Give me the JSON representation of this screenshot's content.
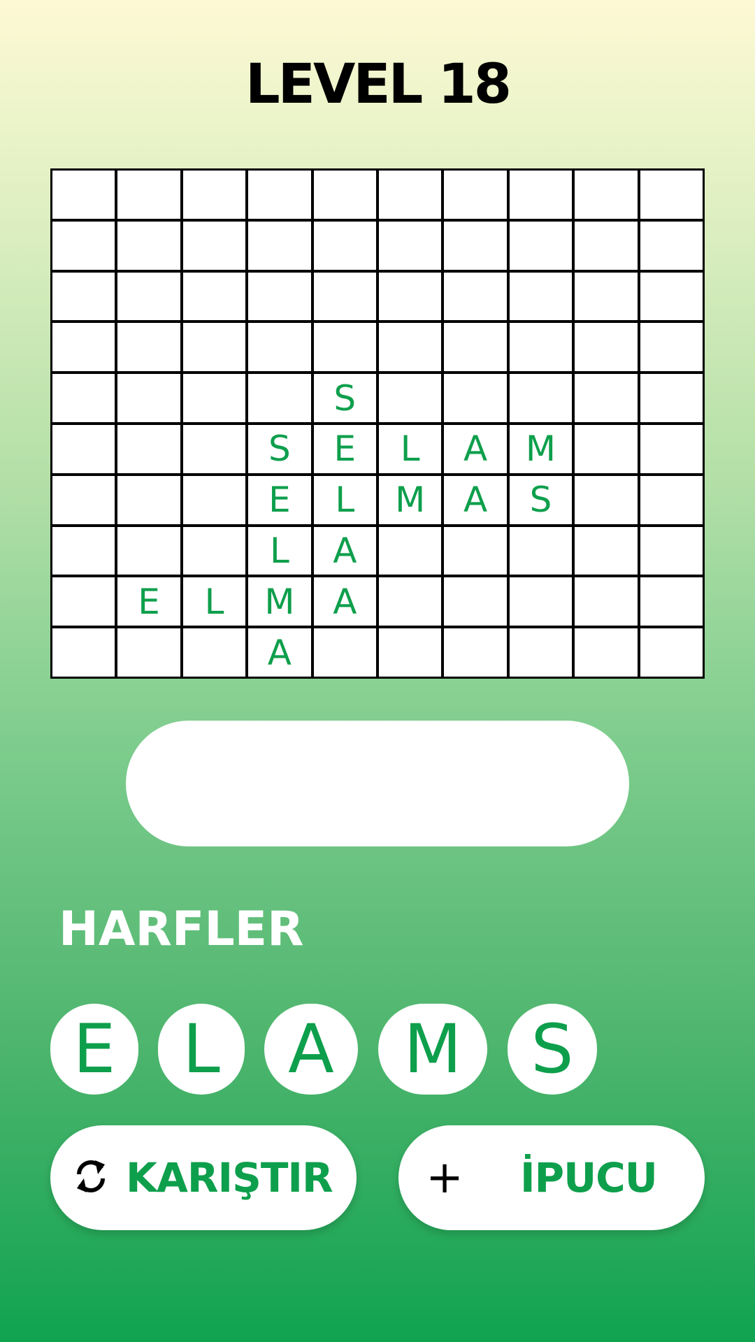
{
  "level_title": "LEVEL 18",
  "grid": {
    "rows": 10,
    "cols": 10,
    "cells": [
      {
        "row": 4,
        "col": 4,
        "letter": "S"
      },
      {
        "row": 5,
        "col": 3,
        "letter": "S"
      },
      {
        "row": 5,
        "col": 4,
        "letter": "E"
      },
      {
        "row": 5,
        "col": 5,
        "letter": "L"
      },
      {
        "row": 5,
        "col": 6,
        "letter": "A"
      },
      {
        "row": 5,
        "col": 7,
        "letter": "M"
      },
      {
        "row": 6,
        "col": 3,
        "letter": "E"
      },
      {
        "row": 6,
        "col": 4,
        "letter": "L"
      },
      {
        "row": 6,
        "col": 5,
        "letter": "M"
      },
      {
        "row": 6,
        "col": 6,
        "letter": "A"
      },
      {
        "row": 6,
        "col": 7,
        "letter": "S"
      },
      {
        "row": 7,
        "col": 3,
        "letter": "L"
      },
      {
        "row": 7,
        "col": 4,
        "letter": "A"
      },
      {
        "row": 8,
        "col": 1,
        "letter": "E"
      },
      {
        "row": 8,
        "col": 2,
        "letter": "L"
      },
      {
        "row": 8,
        "col": 3,
        "letter": "M"
      },
      {
        "row": 8,
        "col": 4,
        "letter": "A"
      },
      {
        "row": 9,
        "col": 3,
        "letter": "A"
      }
    ]
  },
  "answer_input": {
    "value": ""
  },
  "letters_label": "HARFLER",
  "letters": [
    "E",
    "L",
    "A",
    "M",
    "S"
  ],
  "buttons": {
    "shuffle_label": "KARIŞTIR",
    "shuffle_icon": "shuffle-icon",
    "hint_label": "İPUCU",
    "hint_icon": "plus-icon"
  },
  "colors": {
    "accent": "#0e9f4c",
    "grid_line": "#000000",
    "background_top": "#fdf9d4",
    "background_bottom": "#10a350"
  }
}
